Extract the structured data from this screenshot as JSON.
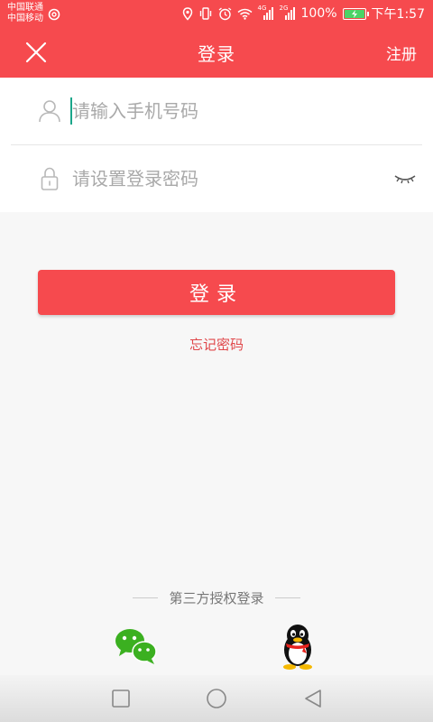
{
  "status_bar": {
    "carrier_1": "中国联通",
    "carrier_2": "中国移动",
    "network_4g": "4G",
    "network_2g": "2G",
    "battery": "100%",
    "time": "下午1:57"
  },
  "header": {
    "title": "登录",
    "register_label": "注册",
    "close_icon": "close-icon"
  },
  "form": {
    "phone_placeholder": "请输入手机号码",
    "phone_value": "",
    "password_placeholder": "请设置登录密码",
    "password_value": "",
    "phone_icon": "user-icon",
    "password_icon": "lock-icon",
    "toggle_icon": "eye-closed-icon"
  },
  "actions": {
    "login_label": "登录",
    "forgot_label": "忘记密码"
  },
  "third_party": {
    "label": "第三方授权登录",
    "providers": [
      {
        "name": "wechat",
        "icon": "wechat-icon"
      },
      {
        "name": "qq",
        "icon": "qq-icon"
      }
    ]
  },
  "colors": {
    "brand_red": "#f64a4e",
    "forgot_text": "#e0474a",
    "caret": "#1aa68a",
    "wechat_green": "#3bb020",
    "background": "#f7f7f7"
  }
}
